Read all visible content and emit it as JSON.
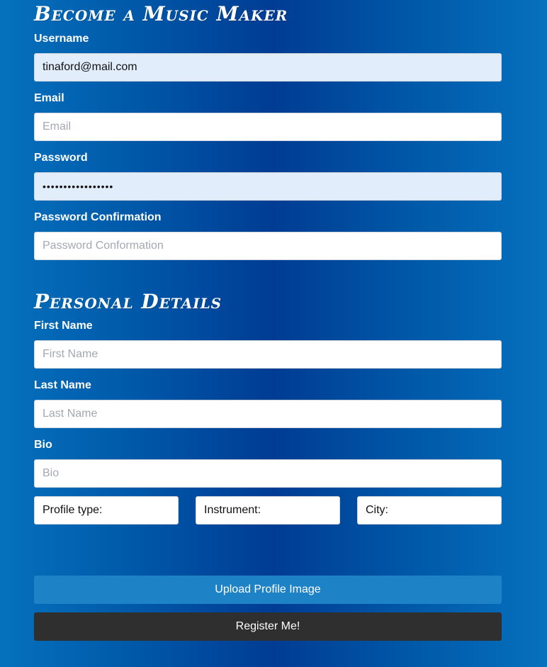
{
  "account": {
    "title": "Become a Music Maker",
    "username": {
      "label": "Username",
      "value": "tinaford@mail.com"
    },
    "email": {
      "label": "Email",
      "placeholder": "Email"
    },
    "password": {
      "label": "Password",
      "value": "•••••••••••••••••"
    },
    "password_confirmation": {
      "label": "Password Confirmation",
      "placeholder": "Password Conformation"
    }
  },
  "personal": {
    "title": "Personal Details",
    "first_name": {
      "label": "First Name",
      "placeholder": "First Name"
    },
    "last_name": {
      "label": "Last Name",
      "placeholder": "Last Name"
    },
    "bio": {
      "label": "Bio",
      "placeholder": "Bio"
    },
    "selects": {
      "profile_type": "Profile type:",
      "instrument": "Instrument:",
      "city": "City:"
    }
  },
  "actions": {
    "upload_label": "Upload Profile Image",
    "register_label": "Register Me!"
  },
  "colors": {
    "background_edge": "#0571bd",
    "background_center": "#003c94",
    "autofill_bg": "#e2edfb",
    "upload_button": "#1e82c6",
    "register_button": "#2f2f2f"
  }
}
